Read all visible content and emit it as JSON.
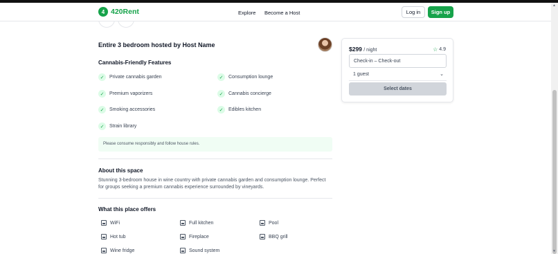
{
  "header": {
    "logo_badge": "4",
    "logo_text": "420Rent",
    "nav": [
      "Explore",
      "Become a Host"
    ],
    "login_label": "Log in",
    "signup_label": "Sign up"
  },
  "listing": {
    "title": "Entire 3 bedroom hosted by Host Name"
  },
  "features": {
    "heading": "Cannabis-Friendly Features",
    "items": [
      "Private cannabis garden",
      "Consumption lounge",
      "Premium vaporizers",
      "Cannabis concierge",
      "Smoking accessories",
      "Edibles kitchen",
      "Strain library"
    ],
    "check_glyph": "✓",
    "notice": "Please consume responsibly and follow house rules."
  },
  "about": {
    "heading": "About this space",
    "description": "Stunning 3-bedroom house in wine country with private cannabis garden and consumption lounge. Perfect for groups seeking a premium cannabis experience surrounded by vineyards."
  },
  "amenities": {
    "heading": "What this place offers",
    "items": [
      "WiFi",
      "Full kitchen",
      "Pool",
      "Hot tub",
      "Fireplace",
      "BBQ grill",
      "Wine fridge",
      "Sound system"
    ]
  },
  "booking": {
    "price": "$299",
    "per_night": "/ night",
    "star_glyph": "☆",
    "rating": "4.9",
    "dates_placeholder": "Check-in – Check-out",
    "guests": "1 guest",
    "chevron_glyph": "⌄",
    "select_label": "Select dates"
  },
  "colors": {
    "brand": "#16a34a",
    "check_bg": "#dcfce7",
    "notice_bg": "#f0fdf4"
  },
  "icons": [
    "logo-icon",
    "check-icon",
    "star-icon",
    "chevron-down-icon",
    "amenity-icon"
  ]
}
